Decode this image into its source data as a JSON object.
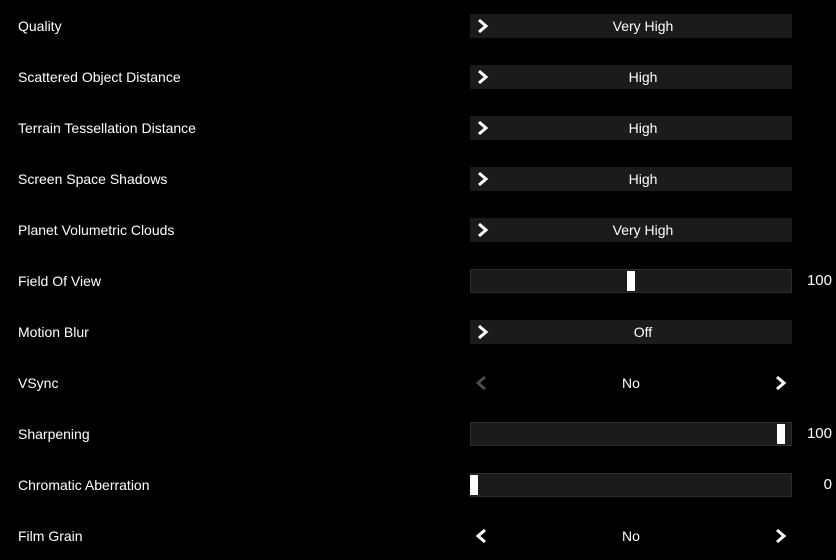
{
  "settings": [
    {
      "label": "Quality",
      "kind": "selector",
      "value": "Very High",
      "left": true,
      "right": false
    },
    {
      "label": "Scattered Object Distance",
      "kind": "selector",
      "value": "High",
      "left": true,
      "right": false
    },
    {
      "label": "Terrain Tessellation Distance",
      "kind": "selector",
      "value": "High",
      "left": true,
      "right": false
    },
    {
      "label": "Screen Space Shadows",
      "kind": "selector",
      "value": "High",
      "left": true,
      "right": false
    },
    {
      "label": "Planet Volumetric Clouds",
      "kind": "selector",
      "value": "Very High",
      "left": true,
      "right": false
    },
    {
      "label": "Field Of View",
      "kind": "slider",
      "display": "100",
      "percent": 50
    },
    {
      "label": "Motion Blur",
      "kind": "selector",
      "value": "Off",
      "left": true,
      "right": false
    },
    {
      "label": "VSync",
      "kind": "noselbox",
      "value": "No",
      "left_dim": true,
      "right": true
    },
    {
      "label": "Sharpening",
      "kind": "slider",
      "display": "100",
      "percent": 97
    },
    {
      "label": "Chromatic Aberration",
      "kind": "slider",
      "display": "0",
      "percent": 1
    },
    {
      "label": "Film Grain",
      "kind": "noselbox",
      "value": "No",
      "left": true,
      "right": true
    }
  ]
}
